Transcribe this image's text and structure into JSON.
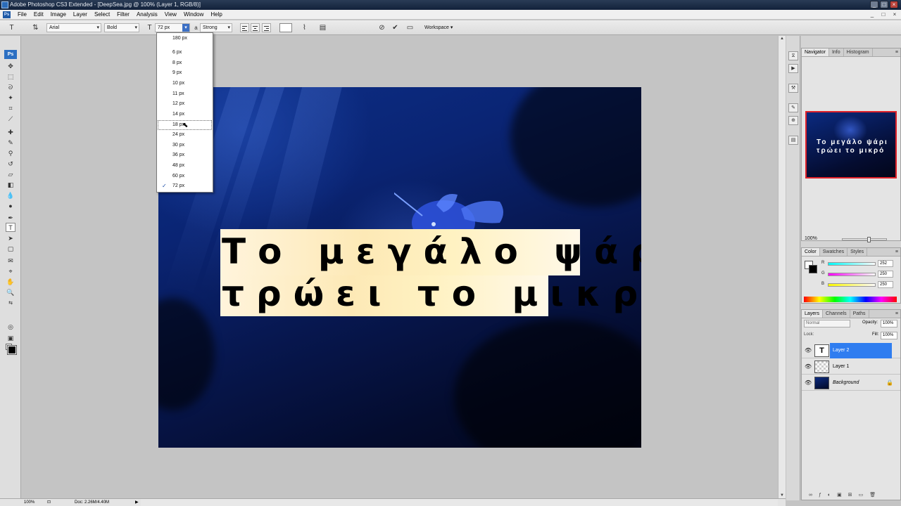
{
  "window": {
    "title": "Adobe Photoshop CS3 Extended - [DeepSea.jpg @ 100% (Layer 1, RGB/8)]",
    "min": "_",
    "max": "□",
    "close": "×"
  },
  "menu": [
    "File",
    "Edit",
    "Image",
    "Layer",
    "Select",
    "Filter",
    "Analysis",
    "View",
    "Window",
    "Help"
  ],
  "options": {
    "font_family": "Arial",
    "font_style": "Bold",
    "font_size": "72 px",
    "aa_icon": "a",
    "antialias": "Strong",
    "workspace": "Workspace ▾"
  },
  "size_dropdown": {
    "items": [
      "180 px",
      "6 px",
      "8 px",
      "9 px",
      "10 px",
      "11 px",
      "12 px",
      "14 px",
      "18 px",
      "24 px",
      "30 px",
      "36 px",
      "48 px",
      "60 px",
      "72 px"
    ],
    "hovered": "18 px",
    "checked": "72 px"
  },
  "canvas_text": {
    "line1": "Το μεγάλο ψάρι",
    "line2": "τρώει το μικρό"
  },
  "navigator": {
    "tabs": [
      "Navigator",
      "Info",
      "Histogram"
    ],
    "preview_line1": "Το μεγάλο ψάρι",
    "preview_line2": "τρώει το μικρό",
    "zoom": "100%"
  },
  "color_panel": {
    "tabs": [
      "Color",
      "Swatches",
      "Styles"
    ],
    "r_label": "R",
    "g_label": "G",
    "b_label": "B",
    "r": "252",
    "g": "250",
    "b": "250"
  },
  "layers_panel": {
    "tabs": [
      "Layers",
      "Channels",
      "Paths"
    ],
    "blend_mode": "Normal",
    "opacity_label": "Opacity:",
    "opacity": "100%",
    "lock_label": "Lock:",
    "fill_label": "Fill:",
    "fill": "100%",
    "layers": [
      {
        "name": "Layer 2",
        "thumb": "T",
        "selected": true
      },
      {
        "name": "Layer 1",
        "thumb": "",
        "selected": false
      },
      {
        "name": "Background",
        "thumb": "",
        "selected": false
      }
    ]
  },
  "status": {
    "zoom": "100%",
    "doc": "Doc: 2.26M/4.40M"
  },
  "colors": {
    "accent": "#2f7df0",
    "nav_border": "#e0222a"
  }
}
